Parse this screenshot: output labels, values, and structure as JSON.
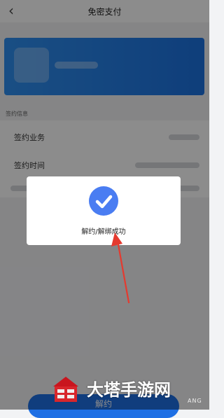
{
  "nav": {
    "back_glyph": "‹",
    "title": "免密支付"
  },
  "section": {
    "title": "签约信息"
  },
  "rows": [
    {
      "label": "签约业务"
    },
    {
      "label": "签约时间"
    }
  ],
  "dialog": {
    "message": "解约/解绑成功",
    "icon": "check-circle-icon",
    "accent": "#4a7df2"
  },
  "bottom": {
    "button_label": "解约"
  },
  "watermark": {
    "text": "大塔手游网",
    "subtext": "ANG"
  },
  "colors": {
    "card": "#2f8ff0",
    "button": "#1e6fe4",
    "arrow": "#e53a2f"
  }
}
